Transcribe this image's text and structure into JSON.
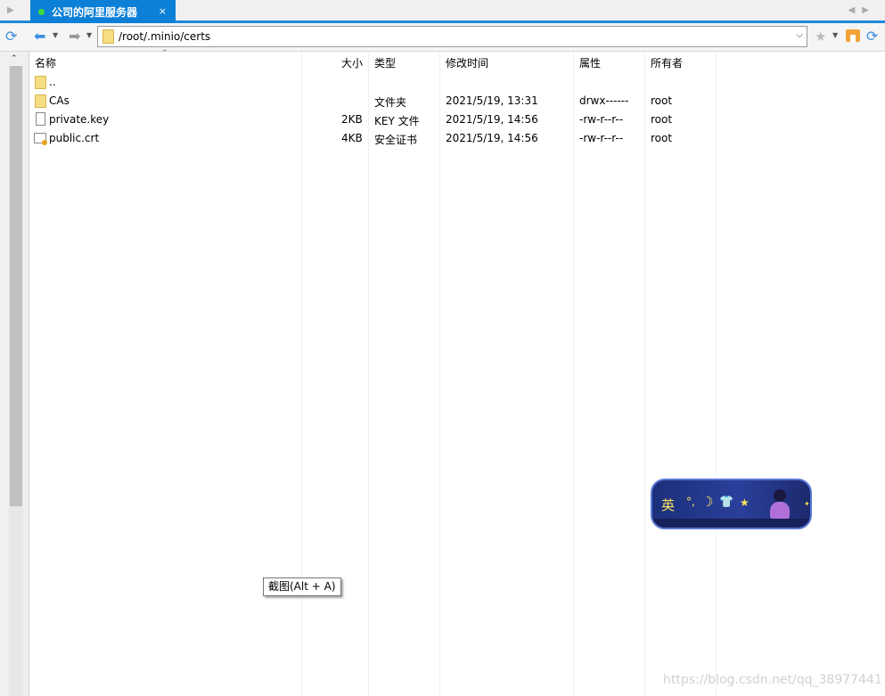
{
  "tabbar": {
    "tab_label": "公司的阿里服务器",
    "tab_close": "×",
    "left_arrow": "▶",
    "right_arrows": "◀▶"
  },
  "toolbar": {
    "path": "/root/.minio/certs",
    "icons": [
      "refresh-icon",
      "back-arrow-icon",
      "forward-arrow-icon",
      "folder-icon",
      "star-icon",
      "home-icon",
      "refresh-icon"
    ]
  },
  "columns": {
    "name": "名称",
    "size": "大小",
    "type": "类型",
    "modified": "修改时间",
    "attributes": "属性",
    "owner": "所有者"
  },
  "files": [
    {
      "icon": "folder-icon",
      "name": "..",
      "size": "",
      "type": "",
      "modified": "",
      "attributes": "",
      "owner": ""
    },
    {
      "icon": "folder-icon",
      "name": "CAs",
      "size": "",
      "type": "文件夹",
      "modified": "2021/5/19, 13:31",
      "attributes": "drwx------",
      "owner": "root"
    },
    {
      "icon": "file-icon",
      "name": "private.key",
      "size": "2KB",
      "type": "KEY 文件",
      "modified": "2021/5/19, 14:56",
      "attributes": "-rw-r--r--",
      "owner": "root"
    },
    {
      "icon": "certificate-icon",
      "name": "public.crt",
      "size": "4KB",
      "type": "安全证书",
      "modified": "2021/5/19, 14:56",
      "attributes": "-rw-r--r--",
      "owner": "root"
    }
  ],
  "tooltip": "截图(Alt + A)",
  "ime": {
    "lang": "英",
    "punct": "°,",
    "moon": "☽",
    "shirt": "👕",
    "star": "★",
    "spark": "✦"
  },
  "watermark": "https://blog.csdn.net/qq_38977441",
  "colors": {
    "accent": "#0c7fd6",
    "folder": "#f7dd82",
    "tab_dot": "#3ddc3d"
  }
}
